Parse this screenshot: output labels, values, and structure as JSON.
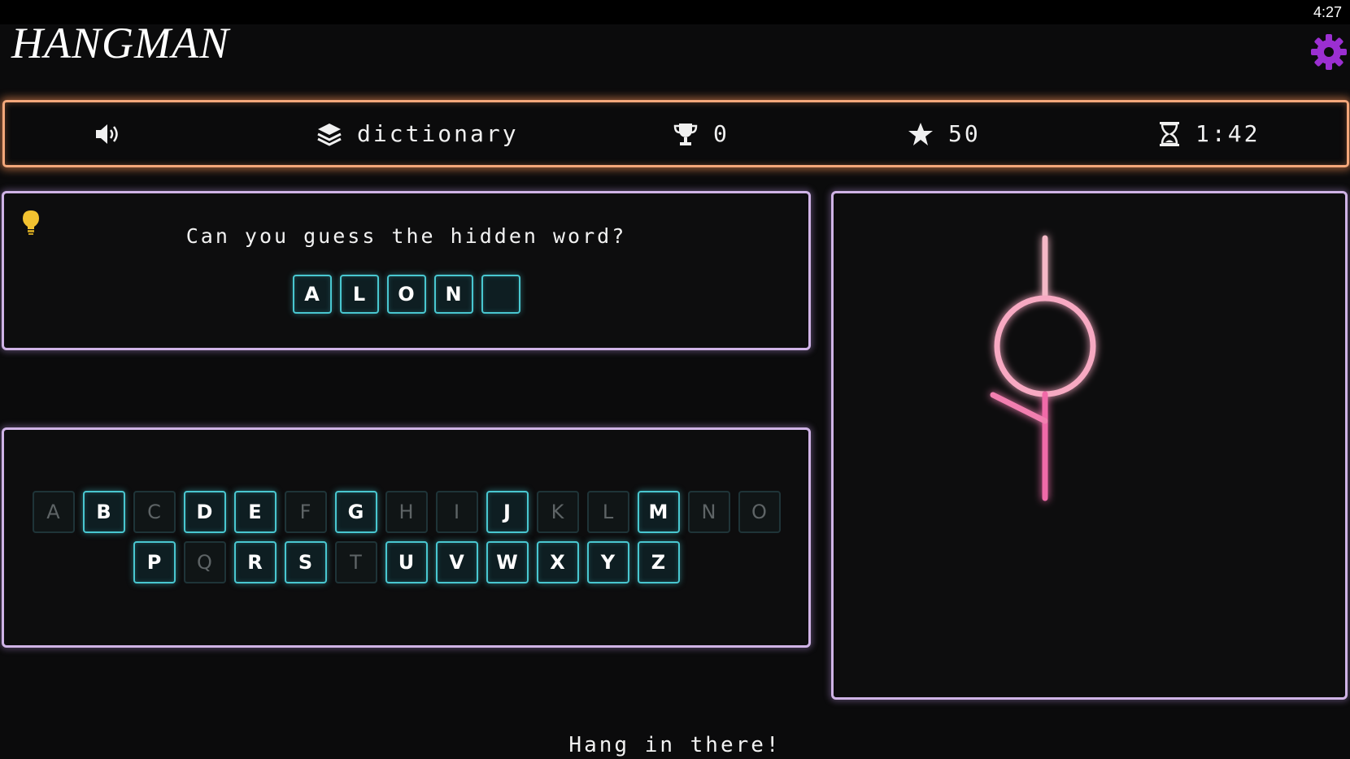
{
  "status_bar": {
    "time": "4:27"
  },
  "app": {
    "title": "HANGMAN"
  },
  "stats": {
    "category": "dictionary",
    "wins": "0",
    "points": "50",
    "timer": "1:42"
  },
  "icons": {
    "sound": "speaker-icon",
    "category": "layers-icon",
    "wins": "trophy-icon",
    "points": "star-icon",
    "timer": "hourglass-icon",
    "hint": "lightbulb-icon",
    "settings": "gear-icon"
  },
  "colors": {
    "accent_orange": "#f3a77a",
    "panel_border": "#cfb3e6",
    "tile_border": "#49c7d0",
    "gear": "#9b2fd1",
    "gallows_pink": "#f06aa8"
  },
  "puzzle": {
    "prompt": "Can you guess the hidden word?",
    "letters": [
      "A",
      "L",
      "O",
      "N",
      ""
    ]
  },
  "keyboard": {
    "rows": [
      [
        {
          "letter": "A",
          "available": false
        },
        {
          "letter": "B",
          "available": true
        },
        {
          "letter": "C",
          "available": false
        },
        {
          "letter": "D",
          "available": true
        },
        {
          "letter": "E",
          "available": true
        },
        {
          "letter": "F",
          "available": false
        },
        {
          "letter": "G",
          "available": true
        },
        {
          "letter": "H",
          "available": false
        },
        {
          "letter": "I",
          "available": false
        },
        {
          "letter": "J",
          "available": true
        },
        {
          "letter": "K",
          "available": false
        },
        {
          "letter": "L",
          "available": false
        },
        {
          "letter": "M",
          "available": true
        },
        {
          "letter": "N",
          "available": false
        },
        {
          "letter": "O",
          "available": false
        }
      ],
      [
        {
          "letter": "P",
          "available": true
        },
        {
          "letter": "Q",
          "available": false
        },
        {
          "letter": "R",
          "available": true
        },
        {
          "letter": "S",
          "available": true
        },
        {
          "letter": "T",
          "available": false
        },
        {
          "letter": "U",
          "available": true
        },
        {
          "letter": "V",
          "available": true
        },
        {
          "letter": "W",
          "available": true
        },
        {
          "letter": "X",
          "available": true
        },
        {
          "letter": "Y",
          "available": true
        },
        {
          "letter": "Z",
          "available": true
        }
      ]
    ]
  },
  "gallows": {
    "parts_shown": [
      "head",
      "body",
      "left-arm"
    ]
  },
  "footer": {
    "message": "Hang in there!"
  }
}
